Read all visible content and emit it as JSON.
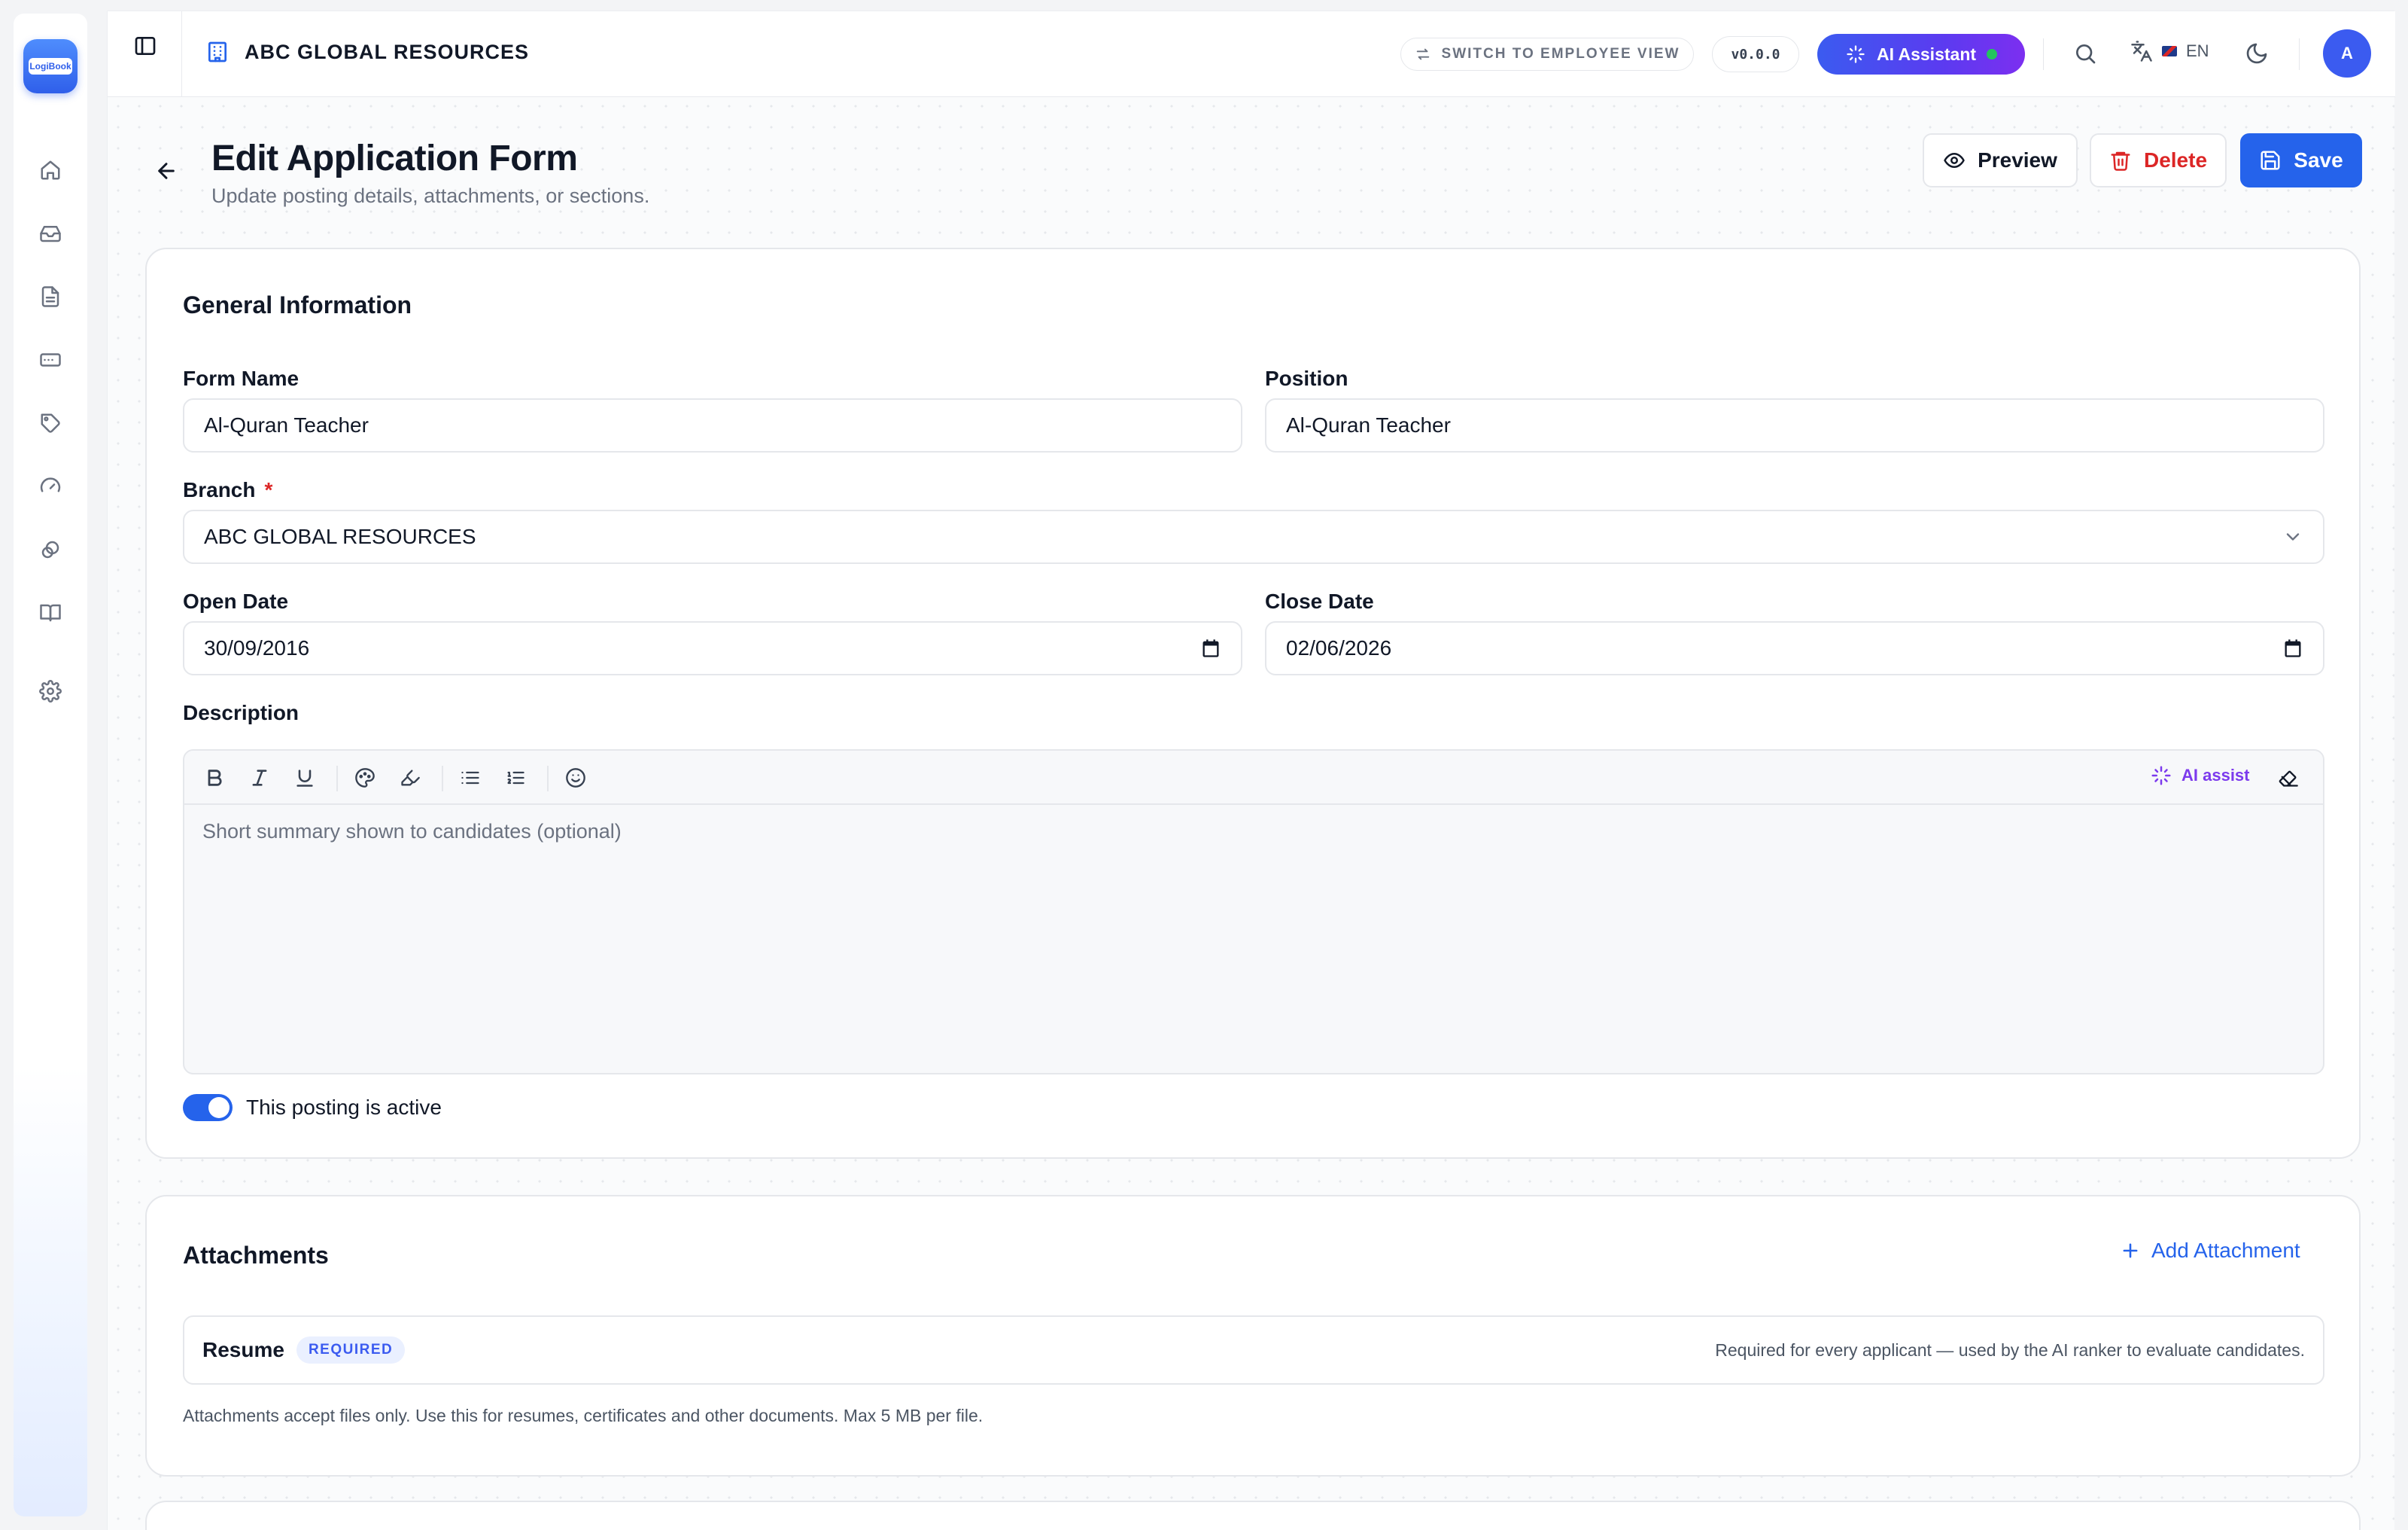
{
  "app": {
    "logo_text": "LogiBook",
    "org_name": "ABC GLOBAL RESOURCES",
    "switch_view": "SWITCH TO EMPLOYEE VIEW",
    "version": "v0.0.0",
    "ai_assistant": "AI Assistant",
    "language": "EN",
    "avatar_initial": "A"
  },
  "sidebar": {
    "items": [
      {
        "icon": "home-icon"
      },
      {
        "icon": "inbox-icon"
      },
      {
        "icon": "document-icon"
      },
      {
        "icon": "card-icon"
      },
      {
        "icon": "tag-icon"
      },
      {
        "icon": "gauge-icon"
      },
      {
        "icon": "link-icon"
      },
      {
        "icon": "book-icon"
      },
      {
        "icon": "settings-icon"
      }
    ]
  },
  "page": {
    "title": "Edit Application Form",
    "subtitle": "Update posting details, attachments, or sections.",
    "preview_label": "Preview",
    "delete_label": "Delete",
    "save_label": "Save"
  },
  "general": {
    "section_title": "General Information",
    "form_name_label": "Form Name",
    "form_name_value": "Al-Quran Teacher",
    "position_label": "Position",
    "position_value": "Al-Quran Teacher",
    "branch_label": "Branch",
    "branch_required": "*",
    "branch_value": "ABC GLOBAL RESOURCES",
    "open_date_label": "Open Date",
    "open_date_value": "30/09/2016",
    "close_date_label": "Close Date",
    "close_date_value": "02/06/2026",
    "description_label": "Description",
    "description_placeholder": "Short summary shown to candidates (optional)",
    "ai_assist_label": "AI assist",
    "active_label": "This posting is active",
    "active": true
  },
  "attachments": {
    "section_title": "Attachments",
    "add_label": "Add Attachment",
    "items": [
      {
        "name": "Resume",
        "badge": "REQUIRED",
        "note": "Required for every applicant — used by the AI ranker to evaluate candidates."
      }
    ],
    "help_text": "Attachments accept files only. Use this for resumes, certificates and other documents. Max 5 MB per file."
  },
  "colors": {
    "primary": "#2563eb",
    "danger": "#dc2626",
    "ai_purple": "#7c3aed",
    "status_online": "#22c55e"
  }
}
